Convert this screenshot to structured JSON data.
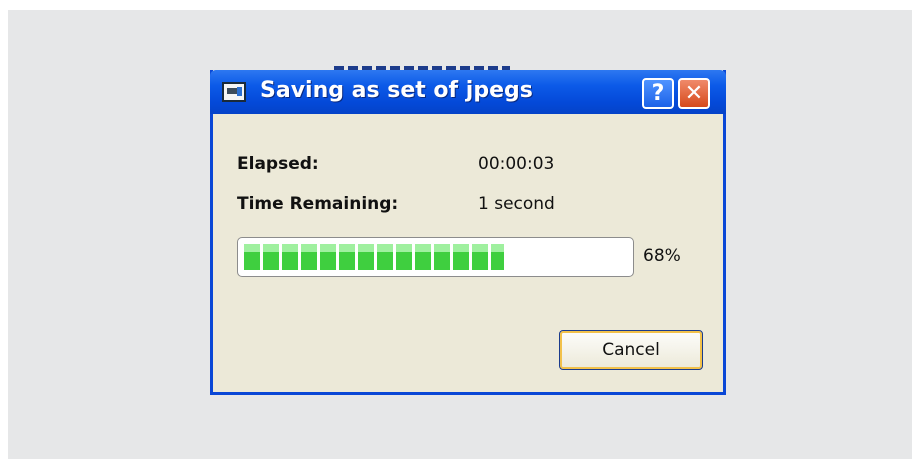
{
  "dialog": {
    "title": "Saving as set of jpegs",
    "title_icon": "image-export-icon",
    "help_glyph": "?",
    "close_glyph": "✕"
  },
  "stats": {
    "elapsed_label": "Elapsed:",
    "elapsed_value": "00:00:03",
    "remaining_label": "Time Remaining:",
    "remaining_value": "1 second"
  },
  "progress": {
    "percent_text": "68%",
    "fraction": 0.68
  },
  "buttons": {
    "cancel_label": "Cancel"
  },
  "colors": {
    "titlebar": "#0449d8",
    "dialog_bg": "#ece9d8",
    "progress_green": "#3fcf3f",
    "close_button": "#d64a1c"
  }
}
